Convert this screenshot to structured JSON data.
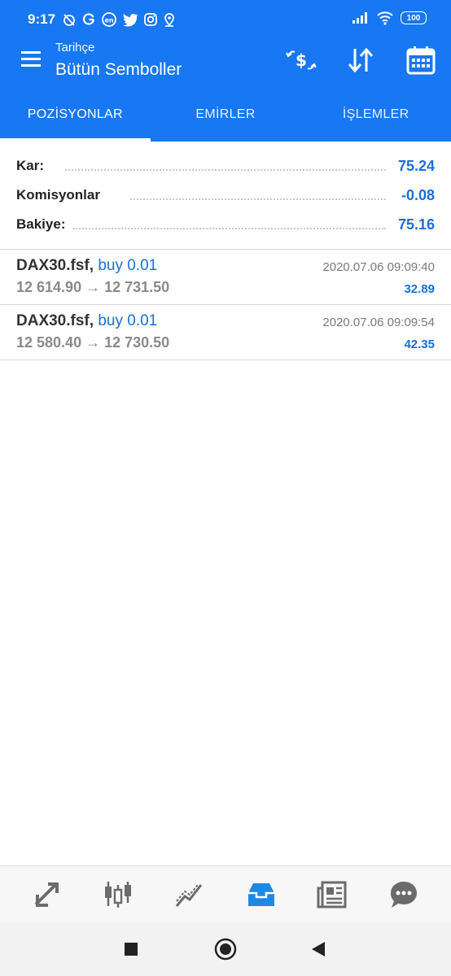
{
  "status_bar": {
    "time": "9:17",
    "battery": "100"
  },
  "header": {
    "subtitle": "Tarihçe",
    "title": "Bütün Semboller"
  },
  "tabs": [
    {
      "label": "POZİSYONLAR",
      "active": true
    },
    {
      "label": "EMİRLER",
      "active": false
    },
    {
      "label": "İŞLEMLER",
      "active": false
    }
  ],
  "summary": [
    {
      "label": "Kar:",
      "value": "75.24"
    },
    {
      "label": "Komisyonlar",
      "value": "-0.08"
    },
    {
      "label": "Bakiye:",
      "value": "75.16"
    }
  ],
  "trades": [
    {
      "symbol": "DAX30.fsf,",
      "side": "buy 0.01",
      "prices": "12 614.90 → 12 731.50",
      "date": "2020.07.06 09:09:40",
      "profit": "32.89"
    },
    {
      "symbol": "DAX30.fsf,",
      "side": "buy 0.01",
      "prices": "12 580.40 → 12 730.50",
      "date": "2020.07.06 09:09:54",
      "profit": "42.35"
    }
  ],
  "bottom_nav": [
    "quotes-icon",
    "chart-icon",
    "trade-icon",
    "history-icon",
    "news-icon",
    "chat-icon"
  ],
  "colors": {
    "accent": "#1877f2",
    "value_blue": "#1a6fd8",
    "active_nav": "#1e88e5"
  }
}
